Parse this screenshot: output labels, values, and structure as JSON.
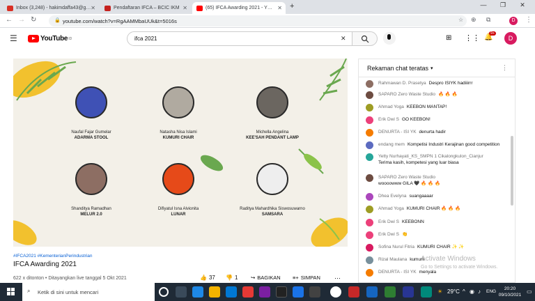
{
  "browser": {
    "tabs": [
      {
        "title": "Inbox (3,248) - hakimdaffa43@g…",
        "color": "#d93025"
      },
      {
        "title": "Pendaftaran IFCA – BCIC IKM",
        "color": "#c5221f"
      },
      {
        "title": "(65) IFCA Awarding 2021 - Y…",
        "color": "#ff0000"
      }
    ],
    "new_tab": "+",
    "url": "youtube.com/watch?v=RgAAMMbaUUk&t=5016s",
    "profile_initial": "D"
  },
  "youtube": {
    "logo_text": "YouTube",
    "logo_sup": "ID",
    "search_value": "ifca 2021",
    "notif_count": "9+",
    "avatar_initial": "D"
  },
  "video": {
    "designers": [
      {
        "name": "Naufal Fajar Gumelar",
        "product": "ADARMA STOOL"
      },
      {
        "name": "Natasha Nisa Islami",
        "product": "KUMURI CHAIR"
      },
      {
        "name": "Michella Angelina",
        "product": "KEE'SAH PENDANT LAMP"
      },
      {
        "name": "Shanditya Ramadhan",
        "product": "MELUR 2.0"
      },
      {
        "name": "Difiyatul Isna Alvionita",
        "product": "LUNAR"
      },
      {
        "name": "Raditya Mahardhika Siswosuwarno",
        "product": "SAMSARA"
      }
    ]
  },
  "info": {
    "hashtags": "#IFCA2021 #KementerianPerindustrian",
    "title": "IFCA Awarding 2021",
    "stats": "622 x ditonton • Ditayangkan live tanggal 5 Okt 2021",
    "likes": "37",
    "dislikes": "1",
    "share": "BAGIKAN",
    "save": "SIMPAN"
  },
  "chat": {
    "header": "Rekaman chat teratas",
    "messages": [
      {
        "author": "Rahmawan D. Prasetya",
        "text": "Despro ISIYK hadiiirrr",
        "color": "#8d6e63"
      },
      {
        "author": "SAPARO Zero Waste Studio",
        "text": "🔥 🔥 🔥",
        "color": "#6d4c41"
      },
      {
        "author": "Ahmad Yoga",
        "text": "KEEBON MANTAP!",
        "color": "#9e9d24"
      },
      {
        "author": "Erik Dwi S",
        "text": "GO KEEBON!",
        "color": "#ec407a"
      },
      {
        "author": "DENURTA - ISI YK",
        "text": "denurta hadir",
        "color": "#f57c00"
      },
      {
        "author": "endang mem",
        "text": "Kompetisi Industri Kerajinan good competition",
        "color": "#5c6bc0"
      },
      {
        "author": "Yetty Nurhayati_KS_SMPN 1 Cikalongkulon_Cianjur",
        "text": "Terima kasih, kompetesi yang luar biasa",
        "color": "#26a69a"
      },
      {
        "author": "SAPARO Zero Waste Studio",
        "text": "woooowww GILA 🖤 🔥 🔥 🔥",
        "color": "#6d4c41"
      },
      {
        "author": "Dhea Evelyna",
        "text": "suangaaaar",
        "color": "#ab47bc"
      },
      {
        "author": "Ahmad Yoga",
        "text": "KUMURI CHAIR 🔥 🔥 🔥",
        "color": "#9e9d24"
      },
      {
        "author": "Erik Dwi S",
        "text": "KEEBONN",
        "color": "#ec407a"
      },
      {
        "author": "Erik Dwi S",
        "text": "👏",
        "color": "#ec407a"
      },
      {
        "author": "Sofina Nurul Fitria",
        "text": "KUMURI CHAIR ✨ ✨",
        "color": "#d81b60"
      },
      {
        "author": "Rizal Maulana",
        "text": "kumurii",
        "color": "#78909c"
      },
      {
        "author": "DENURTA - ISI YK",
        "text": "menyala",
        "color": "#f57c00"
      }
    ]
  },
  "watermark": {
    "line1": "Activate Windows",
    "line2": "Go to Settings to activate Windows."
  },
  "taskbar": {
    "search_placeholder": "Ketik di sini untuk mencari",
    "temperature": "29°C",
    "lang": "ENG",
    "time": "20:20",
    "date": "09/10/2021"
  }
}
